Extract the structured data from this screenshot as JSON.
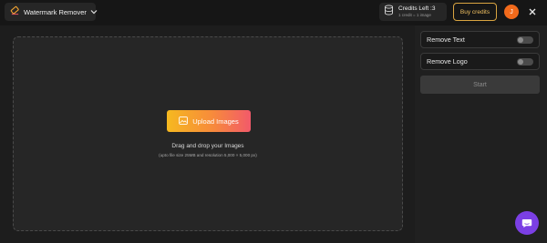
{
  "topbar": {
    "tool_name": "Watermark Remover",
    "credits_main": "Credits Left :3",
    "credits_sub": "1 credit = 1 image",
    "buy_label": "Buy credits",
    "avatar_letter": "J"
  },
  "dropzone": {
    "upload_label": "Upload Images",
    "title": "Drag and drop your Images",
    "subtitle": "(upto file size 25MB and resolution 5,000 × 5,000 px)"
  },
  "options": [
    {
      "label": "Remove Text",
      "enabled": false
    },
    {
      "label": "Remove Logo",
      "enabled": false
    }
  ],
  "start_label": "Start",
  "colors": {
    "accent_gradient": [
      "#f6b91f",
      "#f78a3c",
      "#f25a6a"
    ],
    "buy_border": "#d9a441",
    "avatar_bg": "#f26a1b",
    "chat_bg": "#7b3fe4",
    "background": "#1a1a1a"
  },
  "icons": [
    "eraser-icon",
    "chevron-down-icon",
    "coins-icon",
    "close-icon",
    "image-upload-icon",
    "chat-icon"
  ]
}
